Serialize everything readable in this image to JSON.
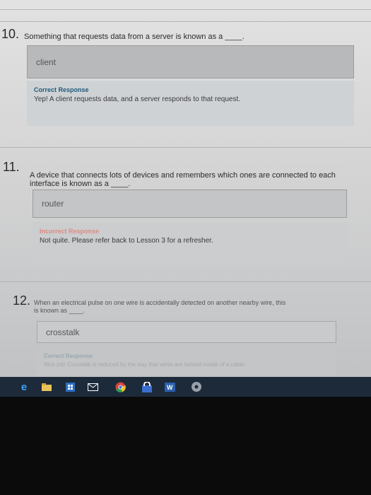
{
  "questions": [
    {
      "number": "10.",
      "text": "Something that requests data from a server is known as a ____.",
      "answer": "client",
      "feedback_title": "Correct Response",
      "feedback_message": "Yep! A client requests data, and a server responds to that request."
    },
    {
      "number": "11.",
      "text_line1": "A device that connects lots of devices and remembers which ones are connected to each",
      "text_line2": "interface is known as a ____.",
      "answer": "router",
      "feedback_title": "Incorrect Response",
      "feedback_message": "Not quite. Please refer back to Lesson 3 for a refresher."
    },
    {
      "number": "12.",
      "text_line1": "When an electrical pulse on one wire is accidentally detected on another nearby wire, this",
      "text_line2": "is known as ____.",
      "answer": "crosstalk",
      "feedback_title": "Correct Response",
      "feedback_message": "Nice job! Crosstalk is reduced by the way that wires are twisted inside of a cable."
    }
  ],
  "colors": {
    "correct_title": "#1f5a78",
    "incorrect_title": "#e08a80",
    "taskbar": "#1d2a3a"
  },
  "taskbar_icons": [
    "edge-icon",
    "file-explorer-icon",
    "store-icon",
    "mail-icon",
    "chrome-icon",
    "lock-icon",
    "word-icon",
    "settings-icon"
  ]
}
